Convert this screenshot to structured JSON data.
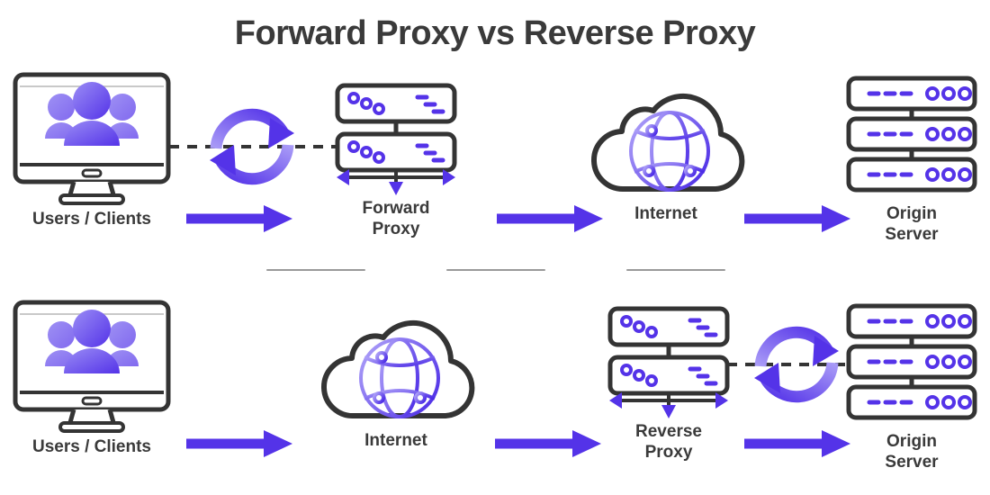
{
  "title": "Forward Proxy vs Reverse Proxy",
  "colors": {
    "arrow_purple": "#5433E8",
    "icon_purple_light": "#8B7BF0",
    "icon_purple_dark": "#5433E8",
    "outline_dark": "#343434",
    "text_dark": "#3a3a3a",
    "divider_gray": "#9a9a9a",
    "background": "#ffffff"
  },
  "rows": [
    {
      "name": "forward-proxy-flow",
      "nodes": [
        {
          "id": "users-clients",
          "label": "Users / Clients",
          "icon": "monitor-users-icon"
        },
        {
          "id": "sync-cycle",
          "label": "",
          "icon": "sync-arrows-icon"
        },
        {
          "id": "forward-proxy",
          "label": "Forward\nProxy",
          "icon": "proxy-server-icon"
        },
        {
          "id": "internet",
          "label": "Internet",
          "icon": "cloud-globe-icon"
        },
        {
          "id": "origin-server",
          "label": "Origin\nServer",
          "icon": "server-stack-icon"
        }
      ],
      "arrows": [
        {
          "id": "arrow-users-to-proxy",
          "icon": "right-arrow-icon"
        },
        {
          "id": "arrow-proxy-to-internet",
          "icon": "right-arrow-icon"
        },
        {
          "id": "arrow-internet-to-origin",
          "icon": "right-arrow-icon"
        }
      ],
      "dashed_links": [
        {
          "id": "dashed-users-to-proxy",
          "icon": "dashed-line-icon"
        }
      ]
    },
    {
      "name": "reverse-proxy-flow",
      "nodes": [
        {
          "id": "users-clients",
          "label": "Users / Clients",
          "icon": "monitor-users-icon"
        },
        {
          "id": "internet",
          "label": "Internet",
          "icon": "cloud-globe-icon"
        },
        {
          "id": "reverse-proxy",
          "label": "Reverse\nProxy",
          "icon": "proxy-server-icon"
        },
        {
          "id": "sync-cycle",
          "label": "",
          "icon": "sync-arrows-icon"
        },
        {
          "id": "origin-server",
          "label": "Origin\nServer",
          "icon": "server-stack-icon"
        }
      ],
      "arrows": [
        {
          "id": "arrow-users-to-internet",
          "icon": "right-arrow-icon"
        },
        {
          "id": "arrow-internet-to-proxy",
          "icon": "right-arrow-icon"
        },
        {
          "id": "arrow-proxy-to-origin",
          "icon": "right-arrow-icon"
        }
      ],
      "dashed_links": [
        {
          "id": "dashed-proxy-to-origin",
          "icon": "dashed-line-icon"
        }
      ]
    }
  ],
  "dividers": [
    {
      "id": "divider-1"
    },
    {
      "id": "divider-2"
    },
    {
      "id": "divider-3"
    }
  ]
}
